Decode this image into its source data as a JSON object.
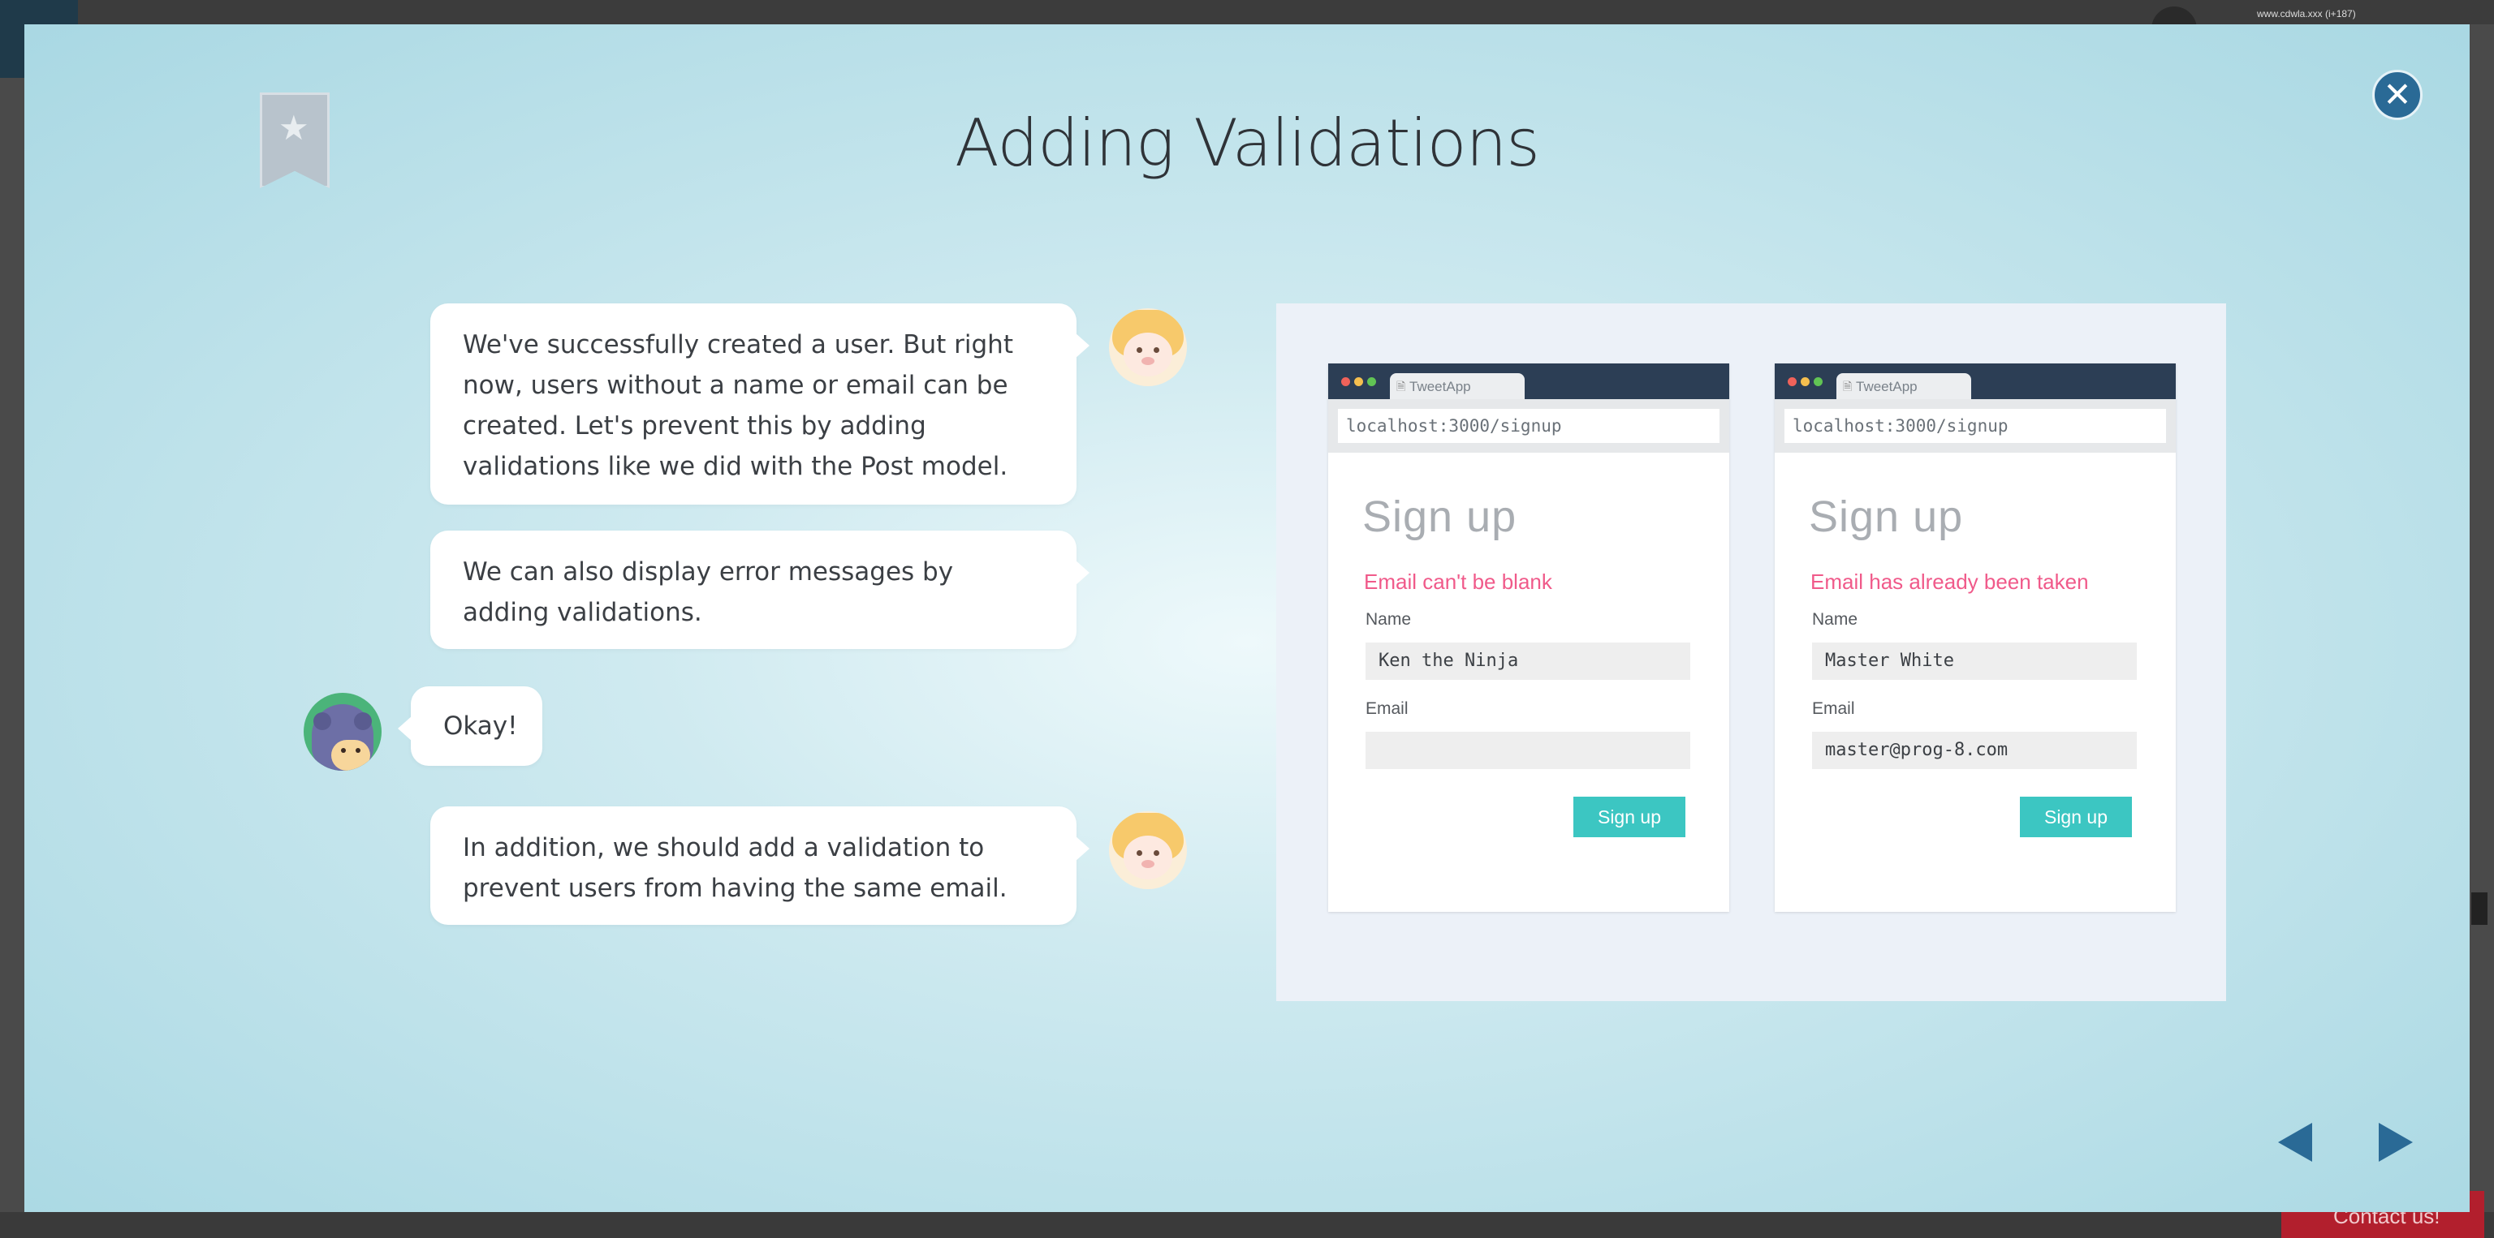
{
  "background": {
    "site_url": "www.cdwla.xxx (i+187)",
    "contact_label": "Contact us!"
  },
  "modal": {
    "title": "Adding Validations",
    "close_icon": "close-icon",
    "bookmark_icon": "star-bookmark-icon"
  },
  "chat": [
    {
      "speaker": "sheep",
      "text": "We've successfully created a user. But right now, users without a name or email can be created. Let's prevent this by adding validations like we did with the Post model."
    },
    {
      "speaker": "sheep",
      "text": "We can also display error messages by adding validations."
    },
    {
      "speaker": "ninja",
      "text": "Okay!"
    },
    {
      "speaker": "sheep",
      "text": "In addition, we should add a validation to prevent users from having the same email."
    }
  ],
  "illustration": {
    "browsers": [
      {
        "tab": "TweetApp",
        "url": "localhost:3000/signup",
        "heading": "Sign up",
        "error": "Email can't be blank",
        "name_label": "Name",
        "name_value": "Ken the Ninja",
        "email_label": "Email",
        "email_value": "",
        "button": "Sign up"
      },
      {
        "tab": "TweetApp",
        "url": "localhost:3000/signup",
        "heading": "Sign up",
        "error": "Email has already been taken",
        "name_label": "Name",
        "name_value": "Master White",
        "email_label": "Email",
        "email_value": "master@prog-8.com",
        "button": "Sign up"
      }
    ]
  },
  "navigation": {
    "prev_icon": "prev-arrow-icon",
    "next_icon": "next-arrow-icon"
  },
  "colors": {
    "accent": "#2a6a96",
    "error": "#f05a8a",
    "button": "#3cc6c2"
  }
}
